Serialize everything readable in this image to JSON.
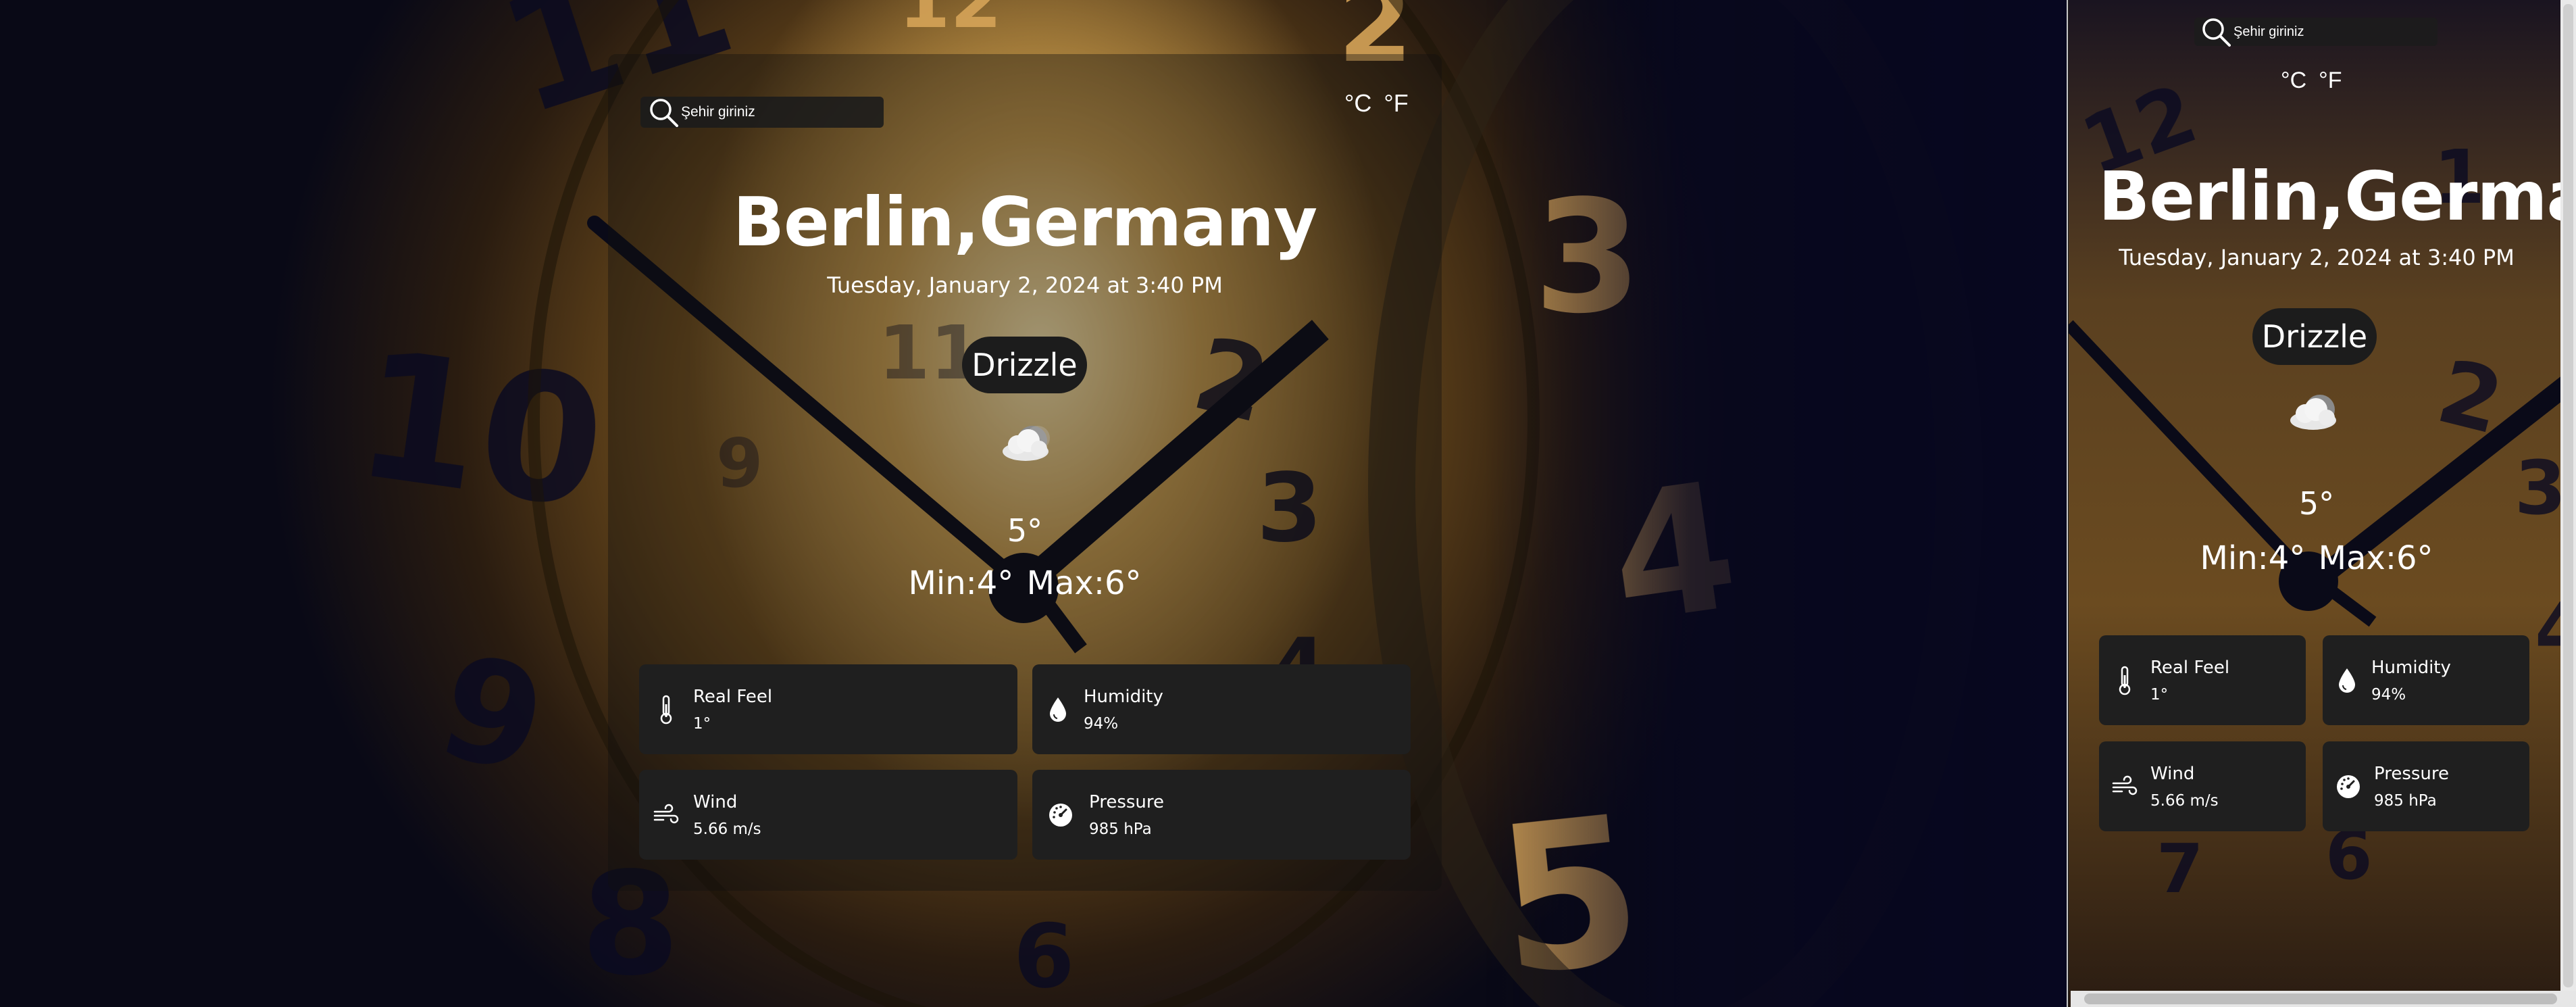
{
  "search": {
    "placeholder": "Şehir giriniz"
  },
  "units": {
    "celsius": "°C",
    "fahrenheit": "°F"
  },
  "location": "Berlin,Germany",
  "datetime": "Tuesday, January 2, 2024 at 3:40 PM",
  "condition": "Drizzle",
  "weather_icon": "cloud-moon-icon",
  "temperature": "5°",
  "min": "Min:4°",
  "max": "Max:6°",
  "details": {
    "real_feel": {
      "label": "Real Feel",
      "value": "1°",
      "icon": "thermometer-icon"
    },
    "humidity": {
      "label": "Humidity",
      "value": "94%",
      "icon": "droplet-icon"
    },
    "wind": {
      "label": "Wind",
      "value": "5.66 m/s",
      "icon": "wind-icon"
    },
    "pressure": {
      "label": "Pressure",
      "value": "985 hPa",
      "icon": "gauge-icon"
    }
  },
  "colors": {
    "tile_bg": "#1f1f1f",
    "text": "#ffffff",
    "background_dark": "#0a0a22",
    "background_gold": "#a77a38"
  }
}
